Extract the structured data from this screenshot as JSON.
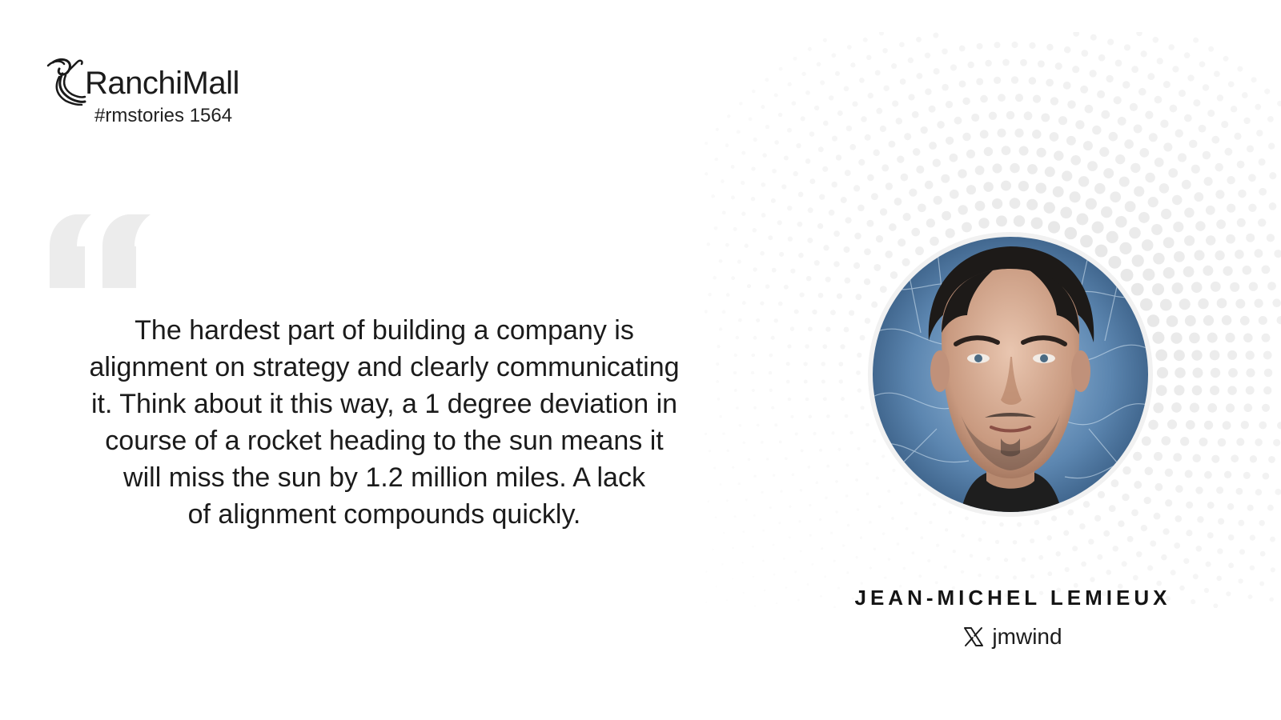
{
  "brand": {
    "name": "RanchiMall",
    "tag": "#rmstories 1564",
    "logo_icon": "ranchimall-logo-icon"
  },
  "quote": {
    "mark_icon": "quotation-mark-icon",
    "mark_color": "#ececec",
    "lines": [
      "The hardest part of building a company is",
      "alignment on strategy and clearly communicating",
      "it. Think about it this way, a 1 degree deviation in",
      "course of a rocket heading to the sun means it",
      "will miss the sun by 1.2 million miles. A lack",
      "of alignment compounds quickly."
    ]
  },
  "person": {
    "name": "JEAN-MICHEL LEMIEUX",
    "handle_icon": "x-logo-icon",
    "handle": "jmwind",
    "portrait_icon": "portrait-photo"
  },
  "colors": {
    "text": "#1c1c1c",
    "halftone": "#e6e6e6",
    "portrait_bg": "#5c86b0"
  }
}
